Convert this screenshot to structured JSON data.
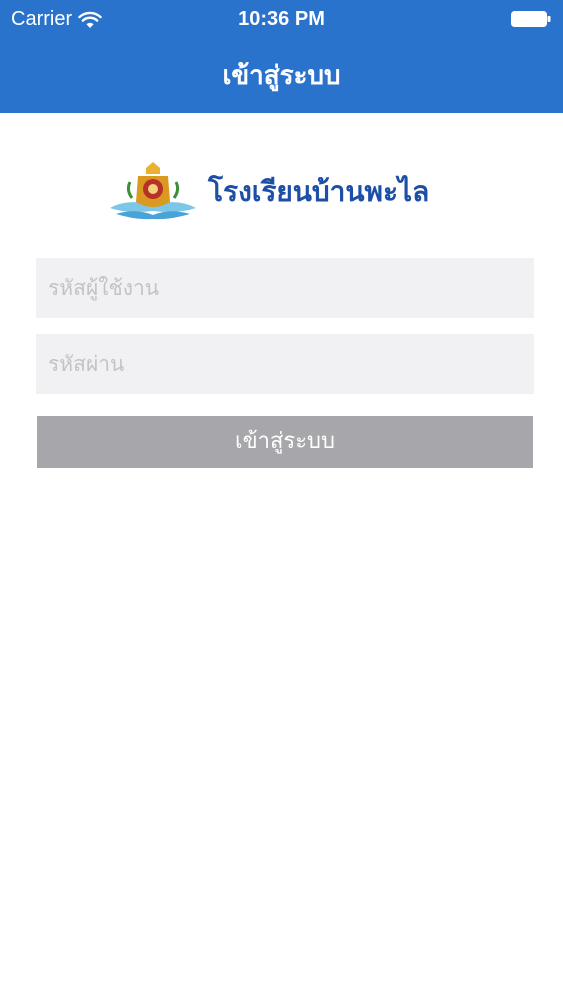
{
  "status_bar": {
    "carrier": "Carrier",
    "time": "10:36 PM",
    "wifi_icon": "wifi-icon",
    "battery_icon": "battery-icon"
  },
  "nav": {
    "title": "เข้าสู่ระบบ",
    "background_color": "#2a73cc"
  },
  "logo": {
    "icon": "school-emblem-icon",
    "school_name": "โรงเรียนบ้านพะไล",
    "text_color": "#1e4fa6"
  },
  "form": {
    "username_placeholder": "รหัสผู้ใช้งาน",
    "username_value": "",
    "password_placeholder": "รหัสผ่าน",
    "password_value": "",
    "login_label": "เข้าสู่ระบบ",
    "button_color": "#a7a6aa",
    "field_color": "#f1f1f4"
  }
}
